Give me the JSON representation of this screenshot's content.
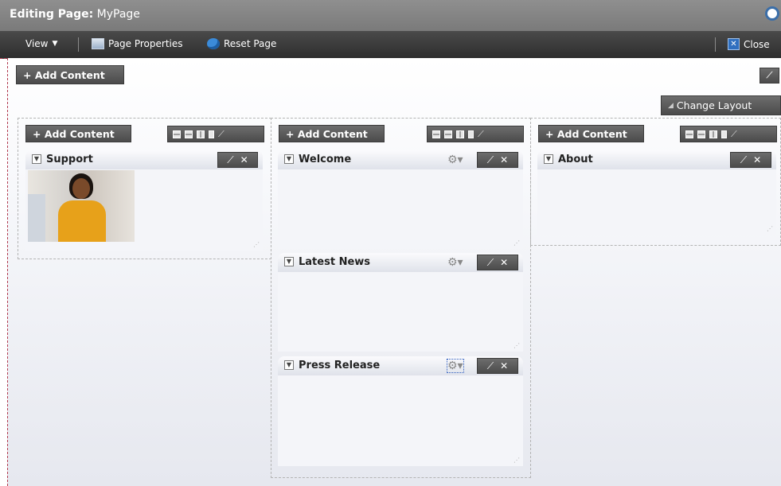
{
  "title": {
    "prefix": "Editing Page:",
    "page_name": "MyPage"
  },
  "toolbar": {
    "view_label": "View",
    "page_properties_label": "Page Properties",
    "reset_page_label": "Reset Page",
    "close_label": "Close"
  },
  "page": {
    "add_content_label": "+ Add Content",
    "change_layout_label": "Change Layout"
  },
  "columns": [
    {
      "add_content_label": "+ Add Content",
      "portlets": [
        {
          "title": "Support"
        }
      ]
    },
    {
      "add_content_label": "+ Add Content",
      "portlets": [
        {
          "title": "Welcome"
        },
        {
          "title": "Latest News"
        },
        {
          "title": "Press Release"
        }
      ]
    },
    {
      "add_content_label": "+ Add Content",
      "portlets": [
        {
          "title": "About"
        }
      ]
    }
  ],
  "icons": {
    "toolbar": [
      "chevron-down-icon",
      "page-properties-icon",
      "reset-page-icon",
      "close-icon"
    ],
    "portlet": [
      "collapse-toggle-icon",
      "gear-icon",
      "pencil-icon",
      "close-icon",
      "resize-grip-icon"
    ]
  }
}
